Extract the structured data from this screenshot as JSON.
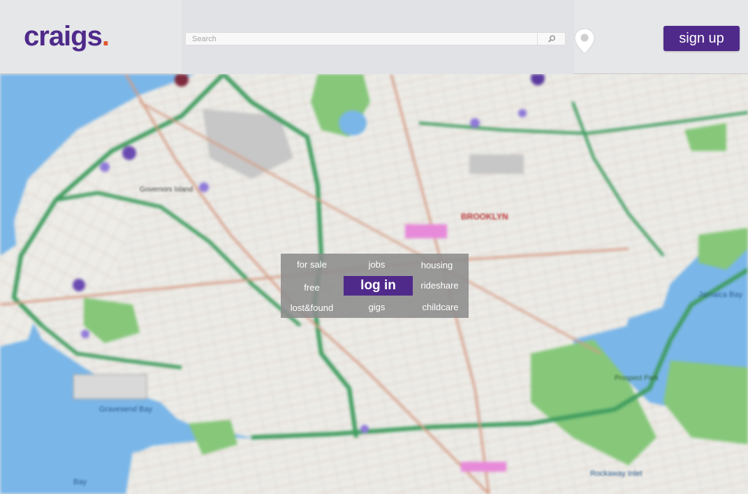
{
  "header": {
    "logo": {
      "text": "craigs",
      "dot": "."
    },
    "search": {
      "placeholder": "Search",
      "value": ""
    },
    "search_icon": "magnifier-icon",
    "location_icon": "map-pin-icon",
    "signup_label": "sign up"
  },
  "map": {
    "labels": {
      "brooklyn": "BROOKLYN",
      "governors_island": "Governors Island",
      "lower_bay": "Bay",
      "gravesend_bay": "Gravesend Bay",
      "jamaica_bay": "Jamaica Bay",
      "rockaway": "Rockaway Inlet",
      "prospect_park": "Prospect Park"
    }
  },
  "categories": {
    "for_sale": "for sale",
    "jobs": "jobs",
    "housing": "housing",
    "free": "free",
    "rideshare": "rideshare",
    "lost_found": "lost&found",
    "gigs": "gigs",
    "childcare": "childcare",
    "login": "log in"
  },
  "colors": {
    "brand_purple": "#4f2a8a",
    "header_bg": "#e6e7e9",
    "water": "#7ab6e8",
    "park": "#86c77a",
    "highway": "#3f9b5e",
    "panel": "#8c8c8c"
  }
}
